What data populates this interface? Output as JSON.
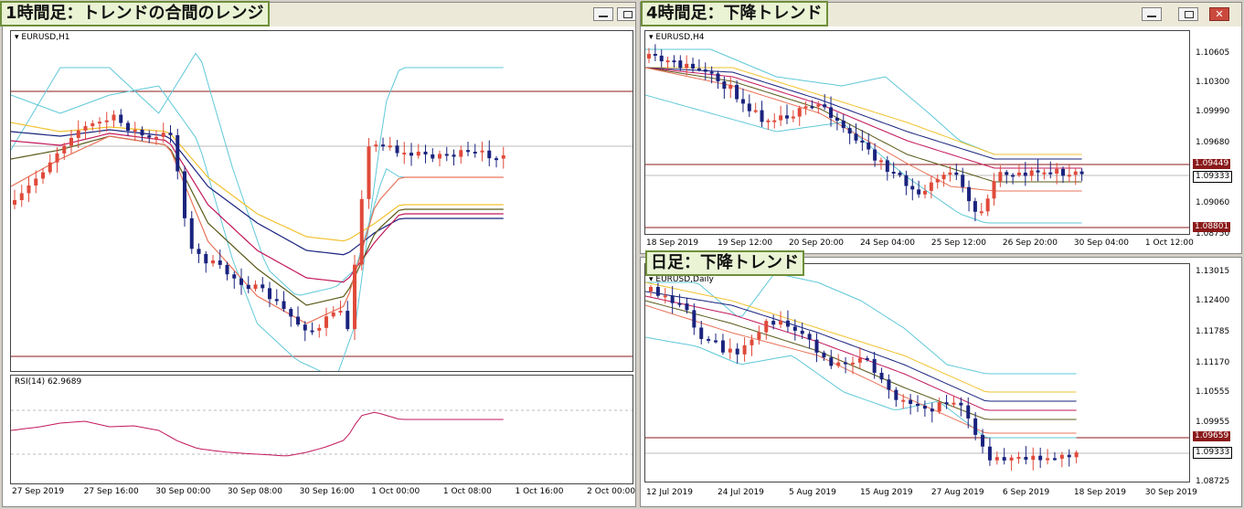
{
  "h1": {
    "title": "1時間足：トレンドの合間のレンジ",
    "symbol": "EURUSD,H1",
    "rsi_label": "RSI(14) 62.9689",
    "x_labels": [
      "27 Sep 2019",
      "27 Sep 16:00",
      "30 Sep 00:00",
      "30 Sep 08:00",
      "30 Sep 16:00",
      "1 Oct 00:00",
      "1 Oct 08:00",
      "1 Oct 16:00",
      "2 Oct 00:00"
    ]
  },
  "h4": {
    "title": "4時間足：下降トレンド",
    "symbol": "EURUSD,H4",
    "y_labels": [
      "1.10605",
      "1.10300",
      "1.09990",
      "1.09680",
      "1.09060",
      "1.08750"
    ],
    "tag_upper": "1.09449",
    "tag_price": "1.09333",
    "tag_lower": "1.08801",
    "x_labels": [
      "18 Sep 2019",
      "19 Sep 12:00",
      "20 Sep 20:00",
      "24 Sep 04:00",
      "25 Sep 12:00",
      "26 Sep 20:00",
      "30 Sep 04:00",
      "1 Oct 12:00"
    ]
  },
  "d1": {
    "title": "日足：下降トレンド",
    "symbol": "EURUSD,Daily",
    "y_labels": [
      "1.13015",
      "1.12400",
      "1.11785",
      "1.11170",
      "1.10555",
      "1.09955",
      "1.08725"
    ],
    "tag_upper": "1.09659",
    "tag_price": "1.09333",
    "x_labels": [
      "12 Jul 2019",
      "24 Jul 2019",
      "5 Aug 2019",
      "15 Aug 2019",
      "27 Aug 2019",
      "6 Sep 2019",
      "18 Sep 2019",
      "30 Sep 2019"
    ]
  },
  "colors": {
    "bull": "#e04a3a",
    "bear": "#1a237e",
    "band": "#5fc8d8",
    "ma1": "#f2c230",
    "ma2": "#1a237e",
    "ma3": "#c2185b",
    "ma4": "#5a5a1a",
    "ma5": "#e8735a",
    "level": "#8b1a1a",
    "rsi": "#c2185b"
  },
  "chart_data": [
    {
      "type": "candlestick",
      "symbol": "EURUSD",
      "timeframe": "H1",
      "levels": [
        1.0945,
        1.088
      ]
    },
    {
      "type": "candlestick",
      "symbol": "EURUSD",
      "timeframe": "H4",
      "levels": [
        1.09449,
        1.08801
      ],
      "last": 1.09333
    },
    {
      "type": "candlestick",
      "symbol": "EURUSD",
      "timeframe": "Daily",
      "levels": [
        1.09659
      ],
      "last": 1.09333
    }
  ]
}
